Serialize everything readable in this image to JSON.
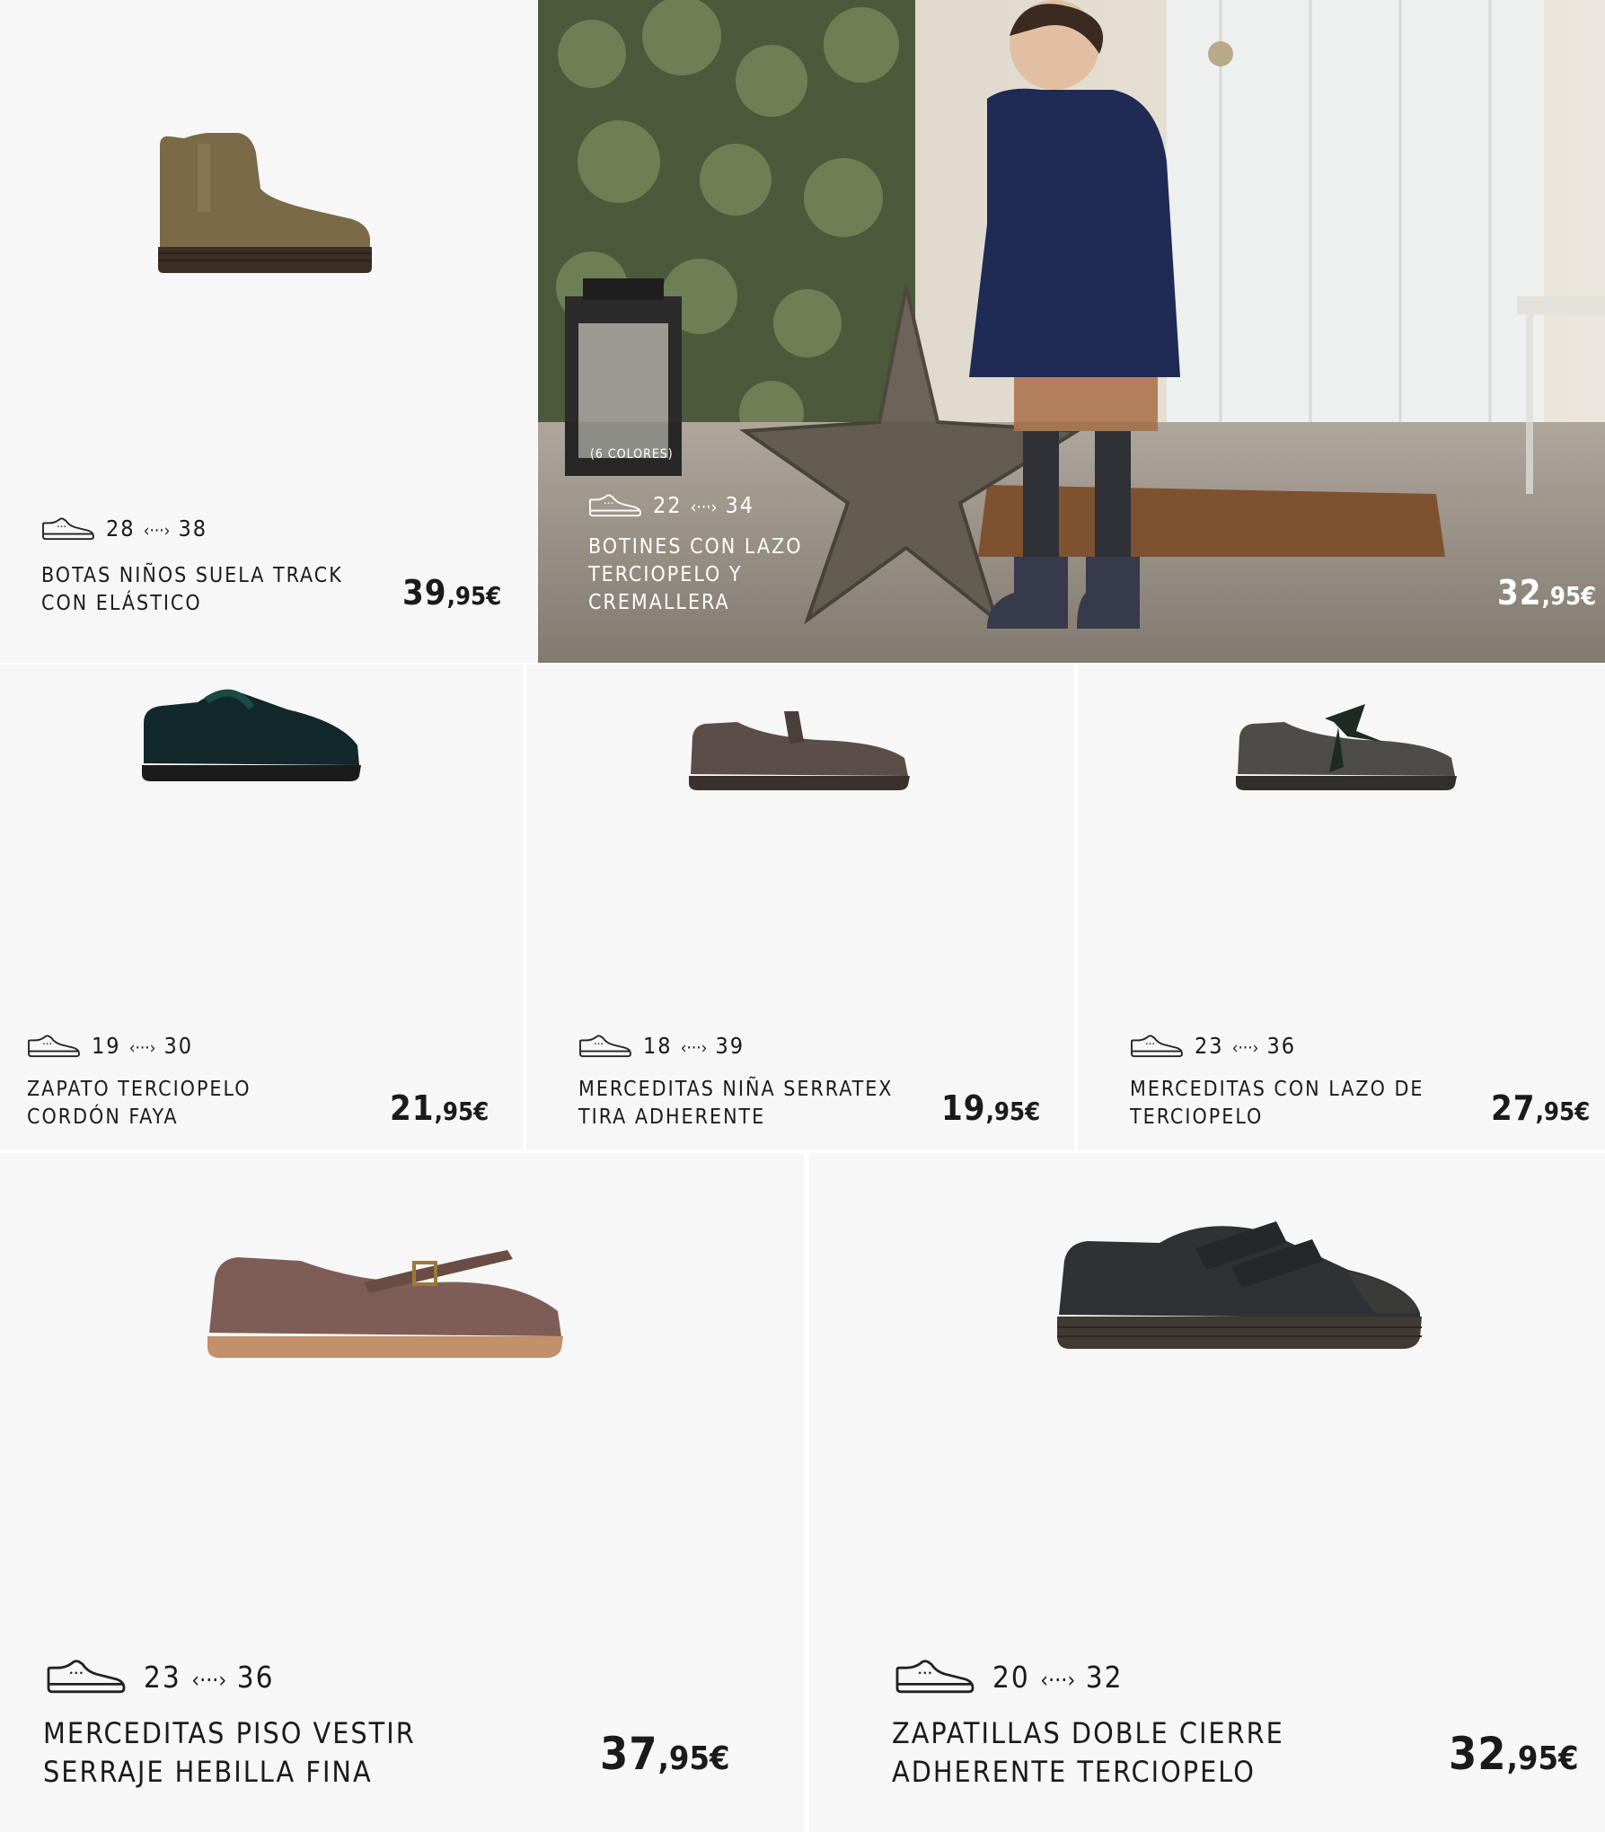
{
  "products": [
    {
      "id": "botas-track",
      "size_from": "28",
      "size_to": "38",
      "arrow": "‹···›",
      "name": "BOTAS NIÑOS SUELA TRACK CON ELÁSTICO",
      "price_int": "39",
      "price_dec": ",95€",
      "icon": "shoe-outline-icon"
    },
    {
      "id": "botines-lazo",
      "colors_note": "(6 COLORES)",
      "size_from": "22",
      "size_to": "34",
      "arrow": "‹···›",
      "name": "BOTINES CON LAZO TERCIOPELO Y CREMALLERA",
      "price_int": "32",
      "price_dec": ",95€",
      "icon": "shoe-outline-icon"
    },
    {
      "id": "zapato-terciopelo",
      "size_from": "19",
      "size_to": "30",
      "arrow": "‹···›",
      "name": "ZAPATO TERCIOPELO CORDÓN FAYA",
      "price_int": "21",
      "price_dec": ",95€",
      "icon": "shoe-outline-icon"
    },
    {
      "id": "merceditas-serratex",
      "size_from": "18",
      "size_to": "39",
      "arrow": "‹···›",
      "name": "MERCEDITAS NIÑA SERRATEX TIRA ADHERENTE",
      "price_int": "19",
      "price_dec": ",95€",
      "icon": "shoe-outline-icon"
    },
    {
      "id": "merceditas-lazo",
      "size_from": "23",
      "size_to": "36",
      "arrow": "‹···›",
      "name": "MERCEDITAS CON LAZO DE TERCIOPELO",
      "price_int": "27",
      "price_dec": ",95€",
      "icon": "shoe-outline-icon"
    },
    {
      "id": "merceditas-hebilla",
      "size_from": "23",
      "size_to": "36",
      "arrow": "‹···›",
      "name": "MERCEDITAS PISO VESTIR SERRAJE HEBILLA FINA",
      "price_int": "37",
      "price_dec": ",95€",
      "icon": "shoe-outline-icon"
    },
    {
      "id": "zapatillas-doble-cierre",
      "size_from": "20",
      "size_to": "32",
      "arrow": "‹···›",
      "name": "ZAPATILLAS DOBLE CIERRE ADHERENTE TERCIOPELO",
      "price_int": "32",
      "price_dec": ",95€",
      "icon": "shoe-outline-icon"
    }
  ],
  "colors": {
    "card_bg": "#f7f7f7",
    "text": "#1b1b1b",
    "photo_overlay_text": "#ffffff"
  }
}
